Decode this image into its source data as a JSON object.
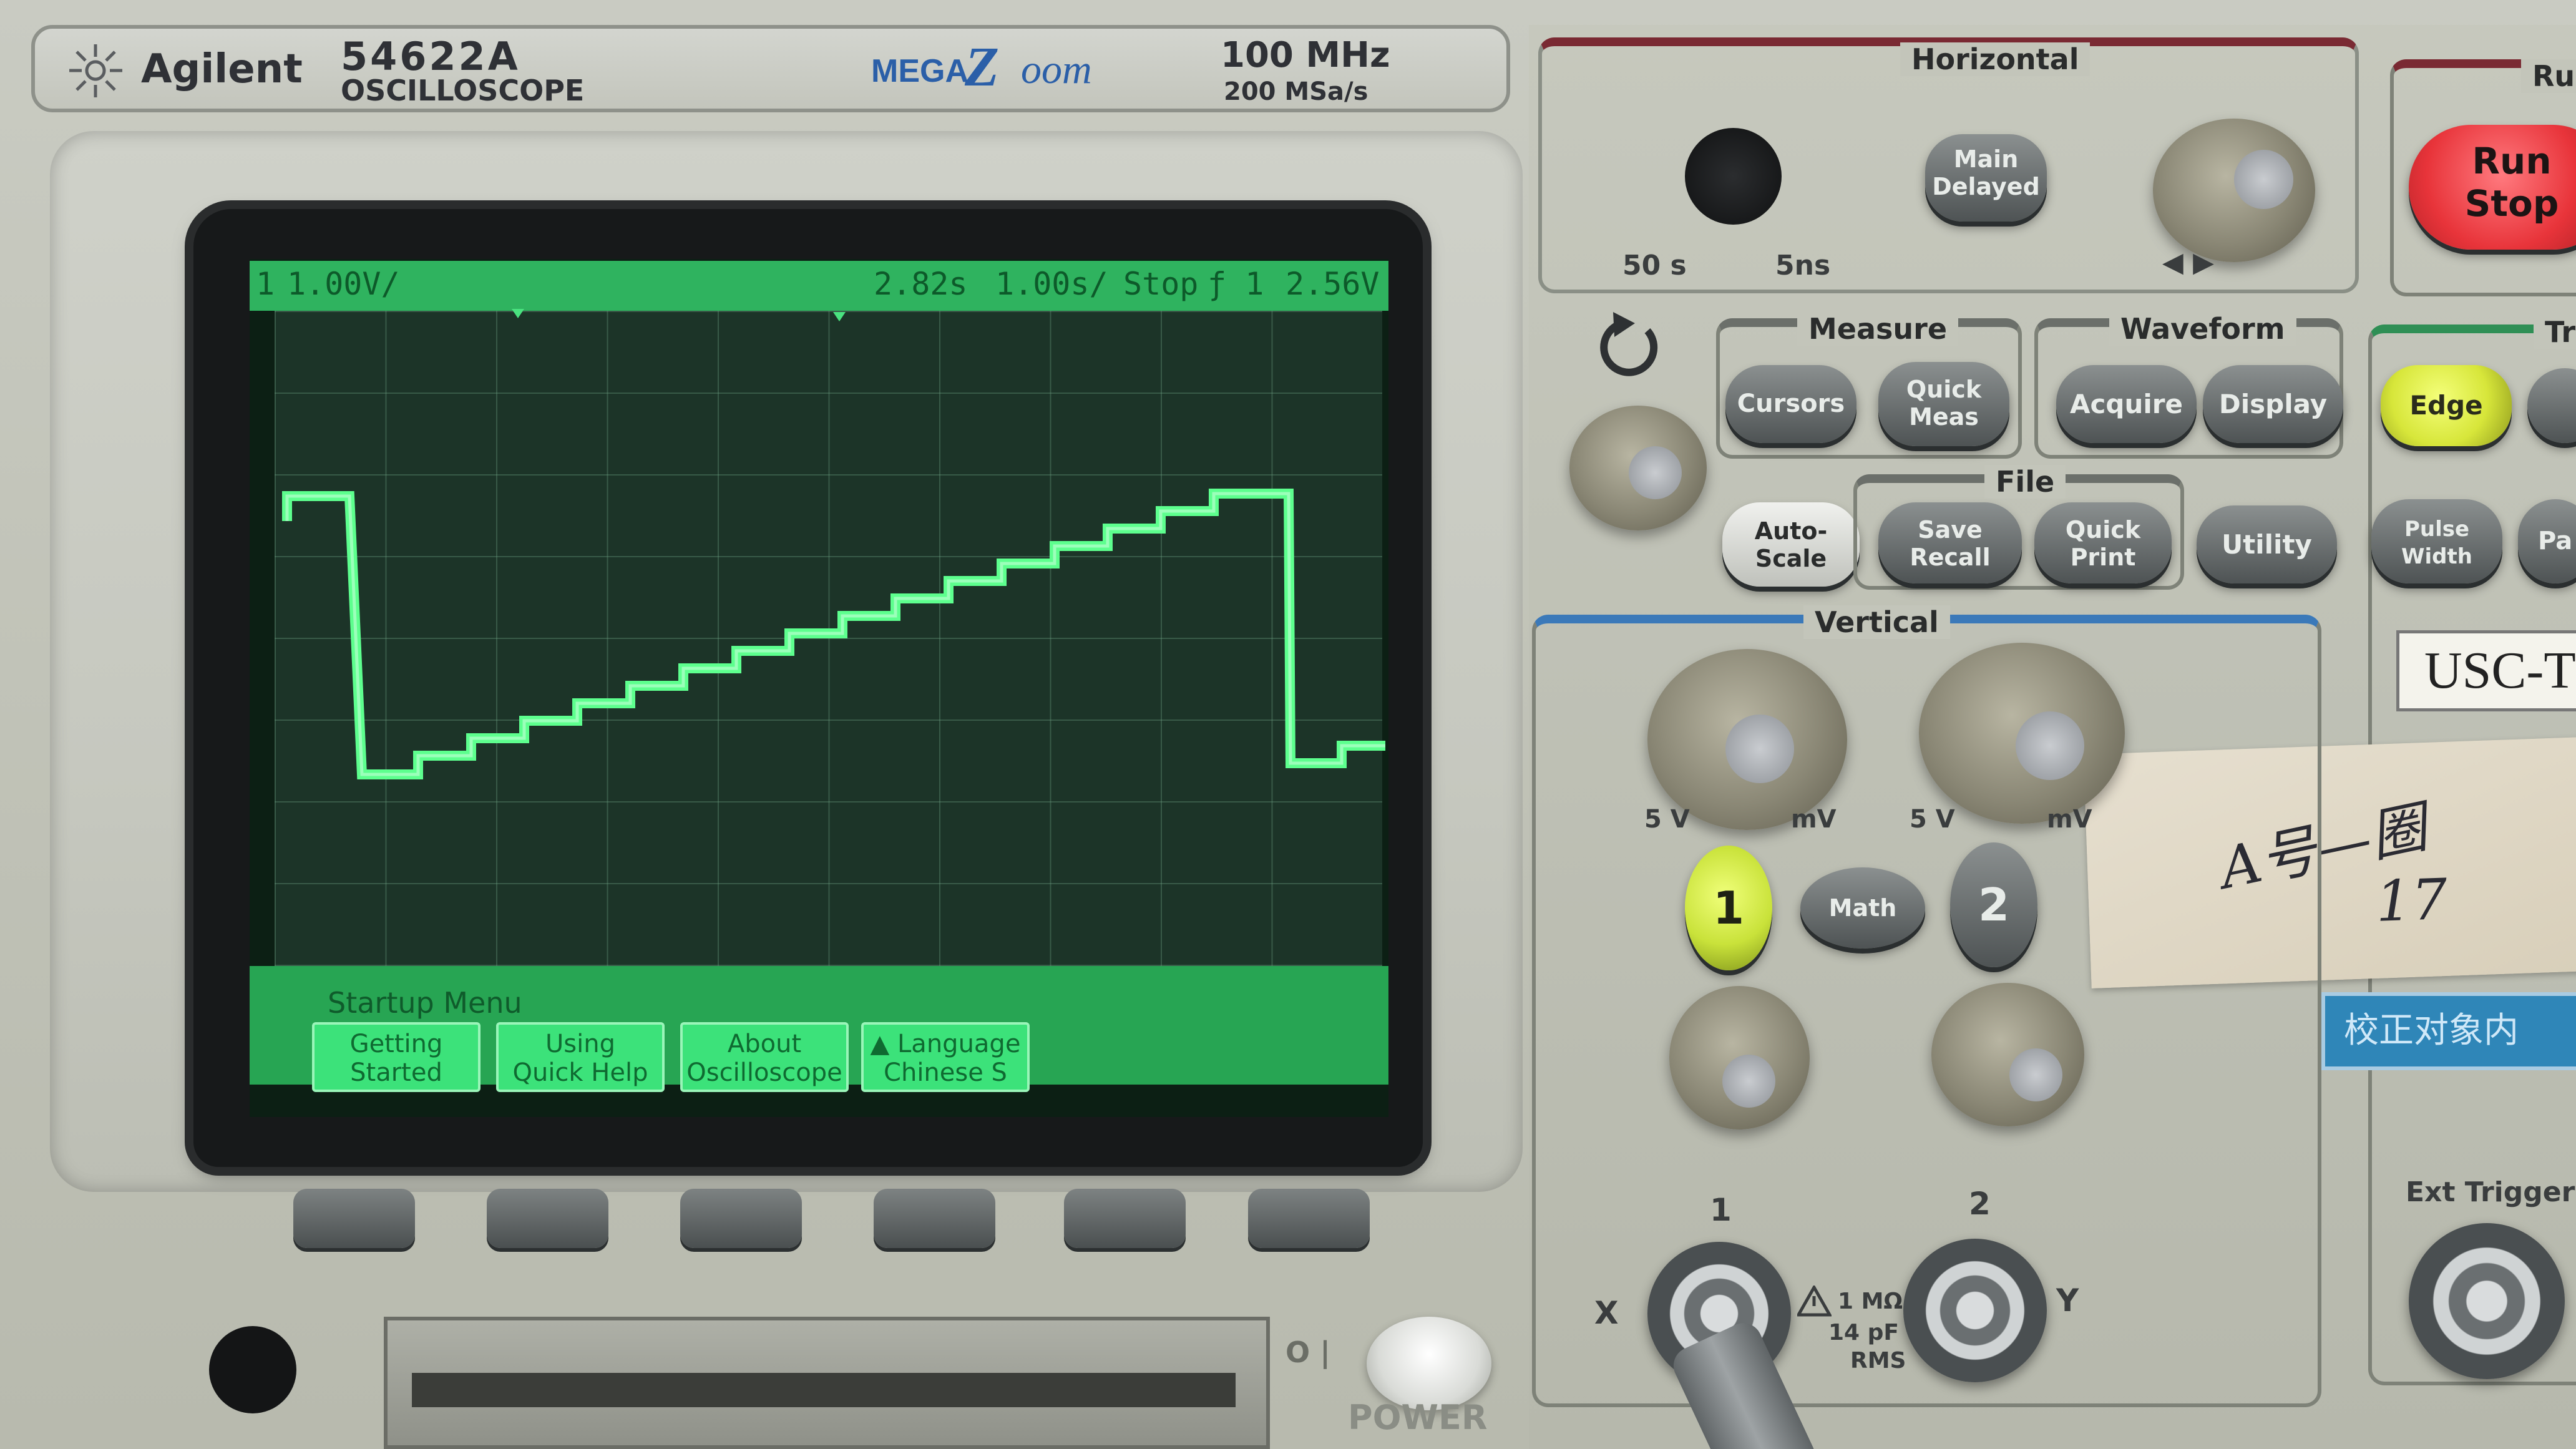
{
  "header": {
    "brand": "Agilent",
    "model": "54622A",
    "type": "OSCILLOSCOPE",
    "megazoom_prefix": "MEGA",
    "megazoom_z": "Z",
    "megazoom_suffix": "oom",
    "bandwidth": "100 MHz",
    "sample_rate": "200 MSa/s"
  },
  "status_bar": {
    "channel": "1",
    "volts_per_div": "1.00V/",
    "delay": "2.82s",
    "time_per_div": "1.00s/",
    "run_state": "Stop",
    "trigger": "ƒ 1",
    "trigger_level": "2.56V"
  },
  "menu": {
    "title": "Startup Menu",
    "softkeys": [
      {
        "line1": "Getting",
        "line2": "Started"
      },
      {
        "line1": "Using",
        "line2": "Quick Help"
      },
      {
        "line1": "About",
        "line2": "Oscilloscope"
      },
      {
        "line1": "▲ Language",
        "line2": "Chinese S"
      }
    ]
  },
  "power_label": "POWER",
  "power_switch": "O |",
  "horizontal": {
    "title": "Horizontal",
    "main_delayed_line1": "Main",
    "main_delayed_line2": "Delayed",
    "range_min": "50 s",
    "range_max": "5ns",
    "arrows": "◀ ▶"
  },
  "run_control": {
    "title": "Ru",
    "run_stop_line1": "Run",
    "run_stop_line2": "Stop"
  },
  "measure": {
    "title": "Measure",
    "cursors": "Cursors",
    "quick_meas_line1": "Quick",
    "quick_meas_line2": "Meas"
  },
  "waveform": {
    "title": "Waveform",
    "acquire": "Acquire",
    "display": "Display"
  },
  "file": {
    "title": "File",
    "save_line1": "Save",
    "save_line2": "Recall",
    "print_line1": "Quick",
    "print_line2": "Print",
    "utility": "Utility"
  },
  "autoscale": {
    "line1": "Auto-",
    "line2": "Scale"
  },
  "trigger": {
    "title": "Tr",
    "edge": "Edge",
    "pulse_line1": "Pulse",
    "pulse_line2": "Width",
    "partial": "Pa",
    "ext_trigger": "Ext Trigger"
  },
  "vertical": {
    "title": "Vertical",
    "scale_left_1": "5 V",
    "scale_right_1": "mV",
    "scale_left_2": "5 V",
    "scale_right_2": "mV",
    "ch1": "1",
    "math": "Math",
    "ch2": "2",
    "input1_label": "1",
    "input2_label": "2",
    "x_label": "X",
    "y_label": "Y",
    "spec_line1": "1 MΩ",
    "spec_line2": "14 pF",
    "spec_line3": "RMS"
  },
  "sticker": {
    "usc": "USC-T",
    "handwriting": "A号—圈",
    "handwriting2": "17",
    "blue_label": "校正对象内"
  },
  "colors": {
    "trace": "#5dff8e",
    "screen_bg": "#1c3428",
    "run_stop": "#e8343a",
    "edge_button": "#d7e63a",
    "ch1_button": "#c9e23a"
  }
}
